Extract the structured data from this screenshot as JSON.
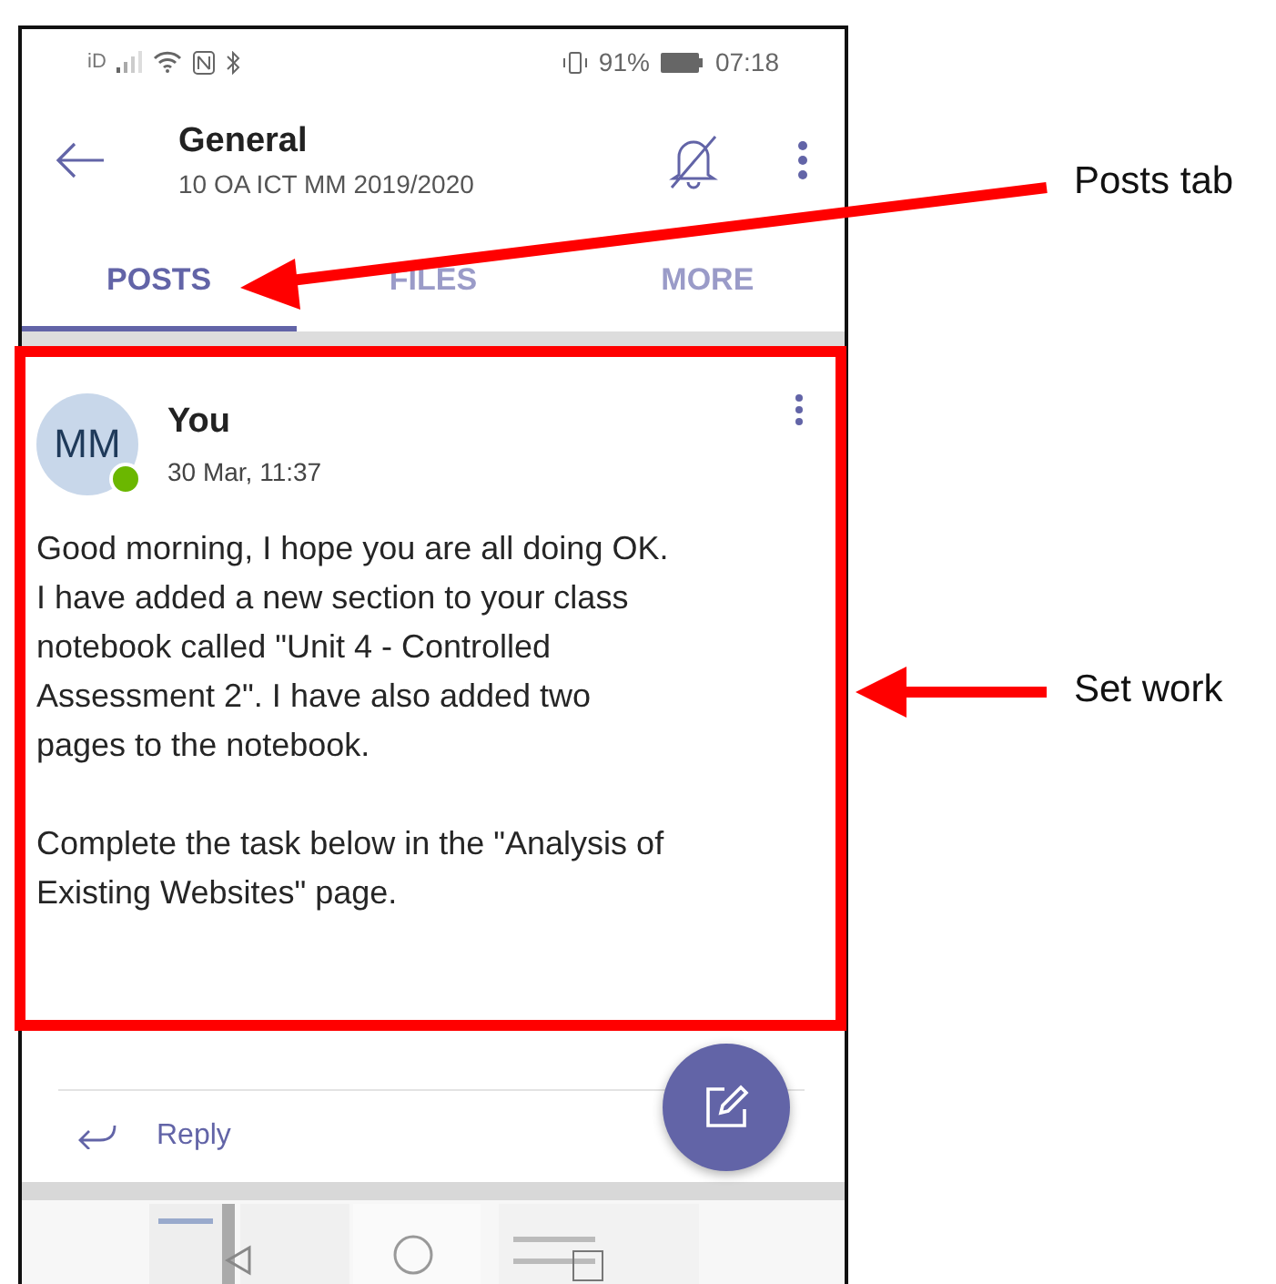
{
  "status_bar": {
    "carrier": "iD",
    "battery": "91%",
    "time": "07:18"
  },
  "header": {
    "title": "General",
    "subtitle": "10 OA ICT MM 2019/2020"
  },
  "tabs": [
    {
      "label": "POSTS",
      "selected": true
    },
    {
      "label": "FILES",
      "selected": false
    },
    {
      "label": "MORE",
      "selected": false
    }
  ],
  "post": {
    "avatar_initials": "MM",
    "online": true,
    "author": "You",
    "time": "30 Mar, 11:37",
    "paragraphs": [
      "Good morning, I hope you are all doing OK. I have added a new section to your class notebook called \"Unit 4 - Controlled Assessment 2\". I have also added two pages to the notebook.",
      "Complete the task below in the \"Analysis of Existing Websites\" page."
    ]
  },
  "reply": {
    "label": "Reply"
  },
  "annotations": [
    {
      "label": "Posts tab"
    },
    {
      "label": "Set work"
    }
  ]
}
